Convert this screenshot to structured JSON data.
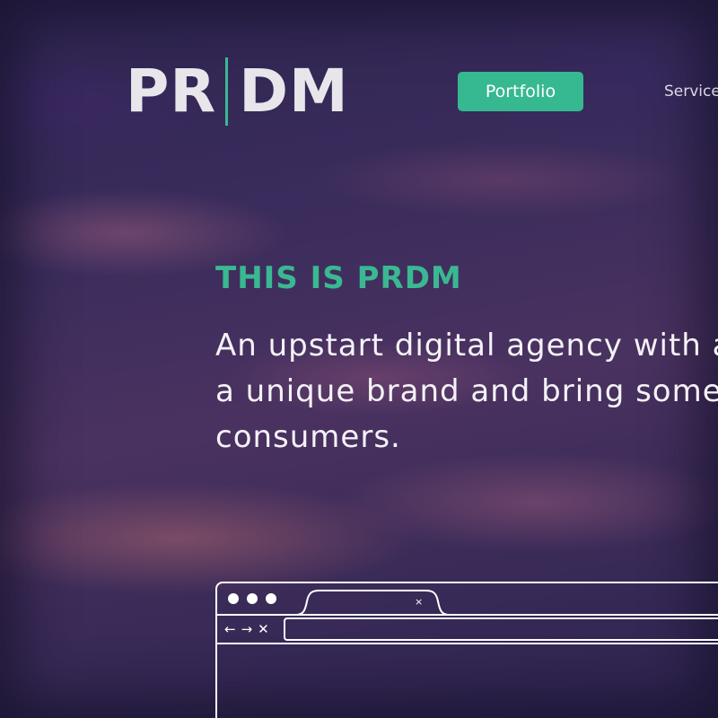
{
  "brand": {
    "logo_left": "PR",
    "logo_right": "DM",
    "accent_color": "#3ab892"
  },
  "nav": {
    "items": [
      {
        "label": "Portfolio",
        "active": true
      },
      {
        "label": "Services",
        "active": false
      }
    ]
  },
  "hero": {
    "kicker": "THIS IS PRDM",
    "intro_lines": [
      "An upstart digital agency with an",
      "a unique brand and bring someth",
      "consumers."
    ]
  },
  "browser_mock": {
    "tab_close_icon": "close-icon",
    "controls": [
      "back-arrow-icon",
      "forward-arrow-icon",
      "close-icon"
    ]
  }
}
